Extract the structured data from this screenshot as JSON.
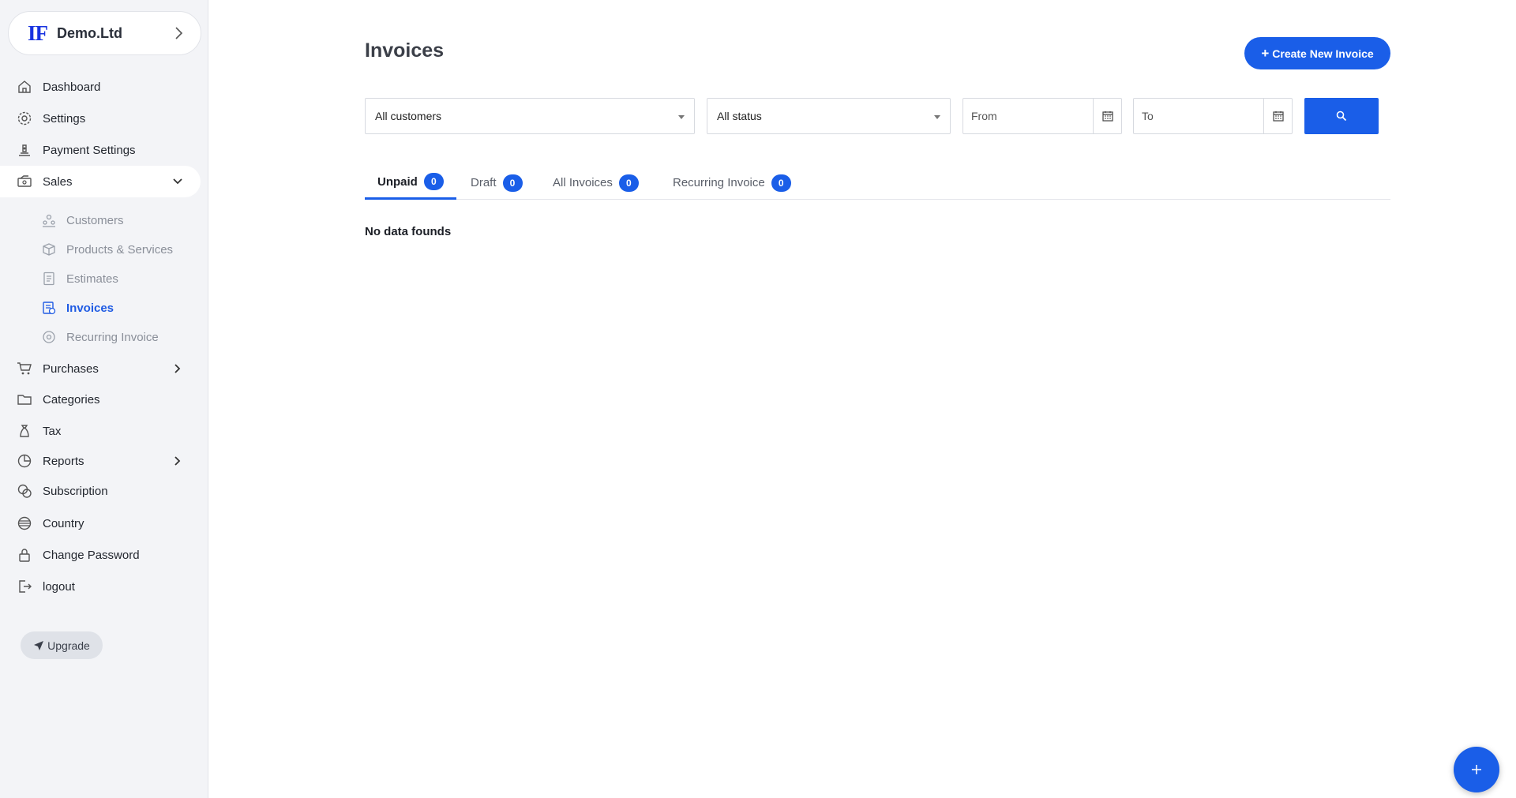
{
  "company": {
    "logo": "IF",
    "name": "Demo.Ltd"
  },
  "nav": {
    "dashboard": "Dashboard",
    "settings": "Settings",
    "payment_settings": "Payment Settings",
    "sales": "Sales",
    "sales_sub": {
      "customers": "Customers",
      "products": "Products & Services",
      "estimates": "Estimates",
      "invoices": "Invoices",
      "recurring": "Recurring Invoice"
    },
    "purchases": "Purchases",
    "categories": "Categories",
    "tax": "Tax",
    "reports": "Reports",
    "subscription": "Subscription",
    "country": "Country",
    "change_password": "Change Password",
    "logout": "logout"
  },
  "upgrade_label": "Upgrade",
  "page": {
    "title": "Invoices",
    "create_button": "Create New Invoice"
  },
  "filters": {
    "customer_select": "All customers",
    "status_select": "All status",
    "from_placeholder": "From",
    "to_placeholder": "To"
  },
  "tabs": [
    {
      "label": "Unpaid",
      "count": "0"
    },
    {
      "label": "Draft",
      "count": "0"
    },
    {
      "label": "All Invoices",
      "count": "0"
    },
    {
      "label": "Recurring Invoice",
      "count": "0"
    }
  ],
  "empty_message": "No data founds",
  "colors": {
    "accent": "#1a5ee8",
    "sidebar_bg": "#f3f4f7",
    "active_sub": "#1f5be3"
  }
}
